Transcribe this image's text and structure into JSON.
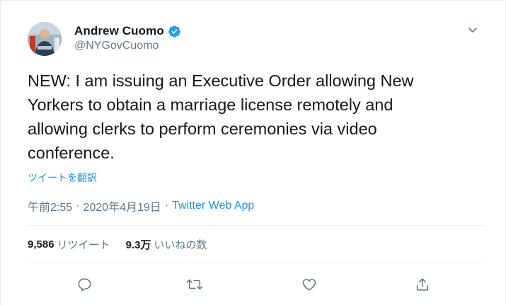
{
  "tweet": {
    "author_name": "Andrew Cuomo",
    "handle": "@NYGovCuomo",
    "text": "NEW: I am issuing an Executive Order allowing New\nYorkers to obtain a marriage license remotely and\nallowing clerks to perform ceremonies via video\nconference.",
    "translate_label": "ツイートを翻訳",
    "time": "午前2:55",
    "separator": "·",
    "date": "2020年4月19日",
    "source": "Twitter Web App"
  },
  "stats": {
    "retweets_count": "9,586",
    "retweets_label": "リツイート",
    "likes_count": "9.3万",
    "likes_label": "いいねの数"
  },
  "icons": {
    "verified": "verified-badge-icon",
    "caret": "chevron-down-icon",
    "reply": "reply-icon",
    "retweet": "retweet-icon",
    "like": "heart-icon",
    "share": "share-icon"
  },
  "colors": {
    "accent": "#1da1f2",
    "link": "#1b95e0",
    "secondary_text": "#657786",
    "primary_text": "#14171a",
    "divider": "#e6ecf0"
  }
}
